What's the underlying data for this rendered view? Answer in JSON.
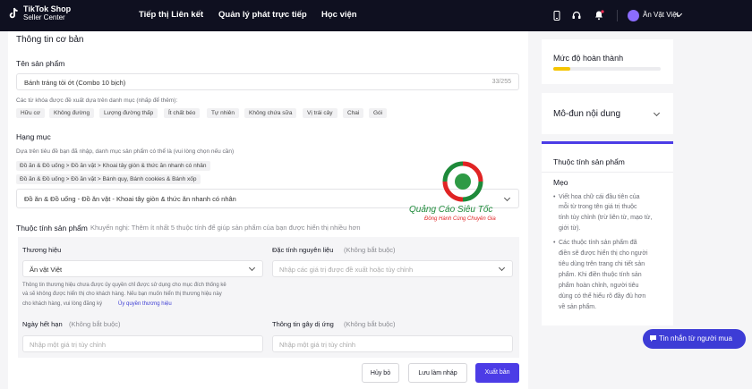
{
  "header": {
    "logo_line1": "TikTok Shop",
    "logo_line2": "Seller Center",
    "nav": [
      "Tiếp thị Liên kết",
      "Quản lý phát trực tiếp",
      "Học viện"
    ],
    "user_name": "Ăn Vặt Việt",
    "icons": [
      "phone-icon",
      "headset-icon",
      "bell-icon",
      "avatar",
      "chevron-down-icon"
    ]
  },
  "basic_info": {
    "title": "Thông tin cơ bản",
    "product_name_label": "Tên sản phẩm",
    "product_name_value": "Bánh tráng tỏi ớt (Combo 10 bịch)",
    "char_count": "33/255",
    "keyword_hint": "Các từ khóa được đề xuất dựa trên danh mục (nhấp để thêm):",
    "keywords": [
      "Hữu cơ",
      "Không đường",
      "Lượng đường thấp",
      "Ít chất béo",
      "Tự nhiên",
      "Không chứa sữa",
      "Vị trái cây",
      "Chai",
      "Gói"
    ]
  },
  "category": {
    "label": "Hạng mục",
    "hint": "Dựa trên tiêu đề bạn đã nhập, danh mục sản phẩm có thể là (vui lòng chọn nếu cần)",
    "suggestions": [
      "Đồ ăn & Đồ uống > Đồ ăn vặt > Khoai tây giòn & thức ăn nhanh có nhân",
      "Đồ ăn & Đồ uống > Đồ ăn vặt > Bánh quy, Bánh cookies & Bánh xốp"
    ],
    "selected": "Đồ ăn & Đồ uống - Đồ ăn vặt - Khoai tây giòn & thức ăn nhanh có nhân"
  },
  "attributes": {
    "title": "Thuộc tính sản phẩm",
    "recommend": "Khuyến nghị: Thêm ít nhất 5 thuộc tính để giúp sản phẩm của bạn được hiển thị nhiều hơn",
    "brand_label": "Thương hiệu",
    "brand_value": "Ăn vặt Việt",
    "brand_note": "Thông tin thương hiệu chưa được ủy quyền chỉ được sử dụng cho mục đích thống kê và sẽ không được hiển thị cho khách hàng. Nếu bạn muốn hiển thị thương hiệu này cho khách hàng, vui lòng đăng ký",
    "brand_note_line1": "Thông tin thương hiệu chưa được ủy quyền chỉ được sử dụng cho mục đích thống kê",
    "brand_note_line2": "và sẽ không được hiển thị cho khách hàng. Nếu bạn muốn hiển thị thương hiệu này",
    "brand_note_line3": "cho khách hàng, vui lòng đăng ký",
    "brand_link": "Ủy quyền thương hiệu",
    "ingredient_label": "Đặc tính nguyên liệu",
    "optional": "(Không bắt buộc)",
    "ingredient_placeholder": "Nhập các giá trị được đề xuất hoặc tùy chỉnh",
    "expiry_label": "Ngày hết hạn",
    "expiry_placeholder": "Nhập một giá trị tùy chỉnh",
    "allergy_label": "Thông tin gây dị ứng",
    "allergy_placeholder": "Nhập một giá trị tùy chỉnh"
  },
  "side": {
    "completion_title": "Mức độ hoàn thành",
    "completion_progress": 0.16,
    "module_title": "Mô-đun nội dung",
    "attr_title": "Thuộc tính sản phẩm",
    "tips_title": "Mẹo",
    "tip1": [
      "Viết hoa chữ cái đầu tiên của",
      "mỗi từ trong tên giá trị thuộc",
      "tính tùy chỉnh (trừ liên từ, mạo từ,",
      "giới từ)."
    ],
    "tip2": [
      "Các thuộc tính sản phẩm đã",
      "điền sẽ được hiển thị cho người",
      "tiêu dùng trên trang chi tiết sản",
      "phẩm. Khi điền thuộc tính sản",
      "phẩm hoàn chỉnh, người tiêu",
      "dùng có thể hiểu rõ đầy đủ hơn",
      "về sản phẩm."
    ]
  },
  "watermark": {
    "brand": "Quảng Cáo Siêu Tốc",
    "slogan": "Đồng Hành Cùng Chuyên Gia"
  },
  "footer": {
    "cancel": "Hủy bỏ",
    "save_draft": "Lưu làm nháp",
    "publish": "Xuất bản"
  },
  "chat_label": "Tin nhắn từ người mua",
  "colors": {
    "accent": "#4c3ce6",
    "progress": "#f5c400",
    "topbar": "#0f1020",
    "link": "#3f3fd4"
  }
}
